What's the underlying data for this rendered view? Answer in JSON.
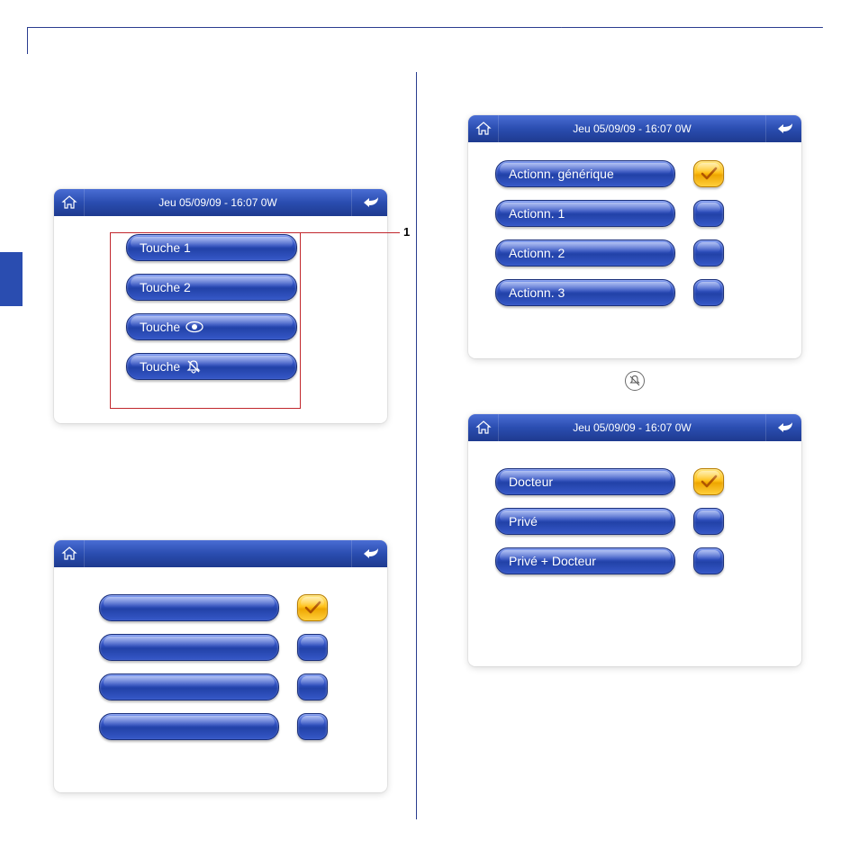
{
  "header_datetime": "Jeu 05/09/09 - 16:07   0W",
  "callout_1": "1",
  "panel1": {
    "items": [
      {
        "label": "Touche 1"
      },
      {
        "label": "Touche 2"
      },
      {
        "label": "Touche"
      },
      {
        "label": "Touche"
      }
    ]
  },
  "panel2": {
    "items": [
      {
        "label": ""
      },
      {
        "label": ""
      },
      {
        "label": ""
      },
      {
        "label": ""
      }
    ]
  },
  "panel3": {
    "title": "Actionn. générique",
    "items": [
      {
        "label": "Actionn. 1"
      },
      {
        "label": "Actionn. 2"
      },
      {
        "label": "Actionn. 3"
      }
    ]
  },
  "panel4": {
    "items": [
      {
        "label": "Docteur"
      },
      {
        "label": "Privé"
      },
      {
        "label": "Privé + Docteur"
      }
    ]
  }
}
